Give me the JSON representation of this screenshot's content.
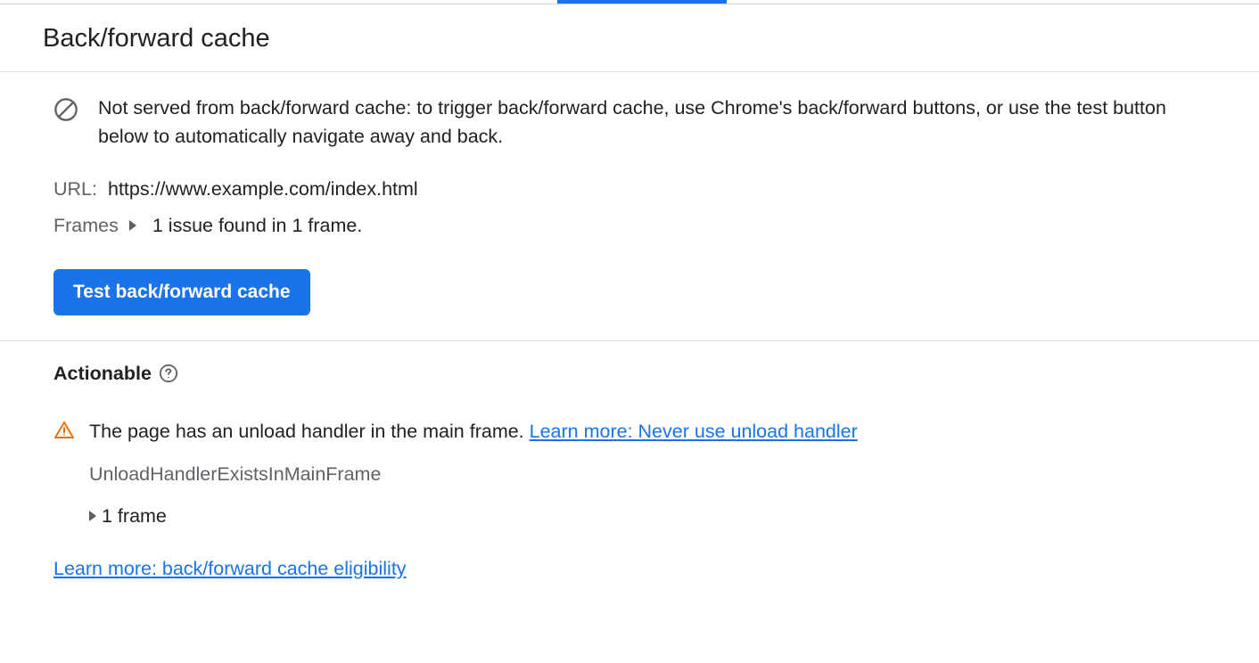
{
  "header": {
    "title": "Back/forward cache"
  },
  "status": {
    "message": "Not served from back/forward cache: to trigger back/forward cache, use Chrome's back/forward buttons, or use the test button below to automatically navigate away and back."
  },
  "meta": {
    "url_label": "URL:",
    "url_value": "https://www.example.com/index.html",
    "frames_label": "Frames",
    "frames_summary": "1 issue found in 1 frame."
  },
  "actions": {
    "test_button_label": "Test back/forward cache"
  },
  "actionable": {
    "heading": "Actionable",
    "issue": {
      "message": "The page has an unload handler in the main frame. ",
      "learn_more_label": "Learn more: Never use unload handler",
      "reason_code": "UnloadHandlerExistsInMainFrame",
      "frame_count_label": "1 frame"
    },
    "bottom_link_label": "Learn more: back/forward cache eligibility"
  }
}
